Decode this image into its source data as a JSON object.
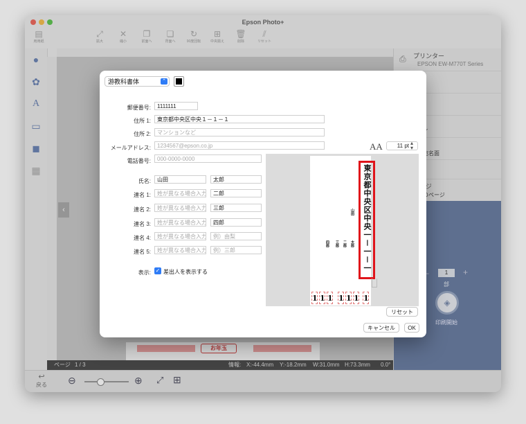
{
  "window": {
    "title": "Epson Photo+"
  },
  "toolbar": {
    "items": [
      "用用紙",
      "拡大",
      "縮小",
      "前面へ",
      "背面へ",
      "90度回転",
      "中央揃え",
      "削除",
      "リセット"
    ]
  },
  "status": {
    "page_label": "ページ",
    "page_value": "1 / 3",
    "info_label": "情報:",
    "x": "X:-44.4mm",
    "y": "Y:-18.2mm",
    "w": "W:31.0mm",
    "h": "H:73.3mm",
    "angle": "0.0°"
  },
  "bottombar": {
    "back_label": "戻る"
  },
  "right_panel": {
    "printer_label": "プリンター",
    "printer_value": "EPSON EW-M770T Series",
    "rows": [
      "イズ",
      "ウト",
      "法",
      "種類",
      "質",
      "ページ"
    ],
    "row_values": [
      "",
      "",
      "レイ",
      "キ宛名面",
      "",
      "てのページ"
    ],
    "copies": "1",
    "copies_unit": "部",
    "print_label": "印刷開始"
  },
  "canvas": {
    "new_year_label": "お年玉"
  },
  "dialog": {
    "font_select": "游教科書体",
    "color": "#000000",
    "font_size_icon": "AA",
    "font_size": "11 pt",
    "fields": {
      "postal_label": "郵便番号:",
      "postal_value": "1111111",
      "address1_label": "住所 1:",
      "address1_value": "東京都中央区中央１－１－１",
      "address2_label": "住所 2:",
      "address2_placeholder": "マンションなど",
      "email_label": "メールアドレス:",
      "email_placeholder": "1234567@epson.co.jp",
      "phone_label": "電話番号:",
      "phone_placeholder": "000-0000-0000",
      "name_label": "氏名:",
      "last_name": "山田",
      "first_name": "太郎",
      "joint1_label": "連名 1:",
      "joint2_label": "連名 2:",
      "joint3_label": "連名 3:",
      "joint4_label": "連名 4:",
      "joint5_label": "連名 5:",
      "joint_last_placeholder": "姓が異なる場合入力",
      "joint1_first": "二郎",
      "joint2_first": "三郎",
      "joint3_first": "四郎",
      "joint4_first_placeholder": "例）由梨",
      "joint5_first_placeholder": "例）三郎",
      "display_label": "表示:",
      "show_sender_label": "差出人を表示する"
    },
    "preview": {
      "address_vertical": "東京都中央区中央一－一－一",
      "name_main": "山田",
      "names": [
        "太郎",
        "二郎",
        "三郎",
        "四郎"
      ],
      "zip_digits": [
        "1",
        "1",
        "1",
        "1",
        "1",
        "1",
        "1"
      ]
    },
    "reset_label": "リセット",
    "cancel_label": "キャンセル",
    "ok_label": "OK"
  }
}
